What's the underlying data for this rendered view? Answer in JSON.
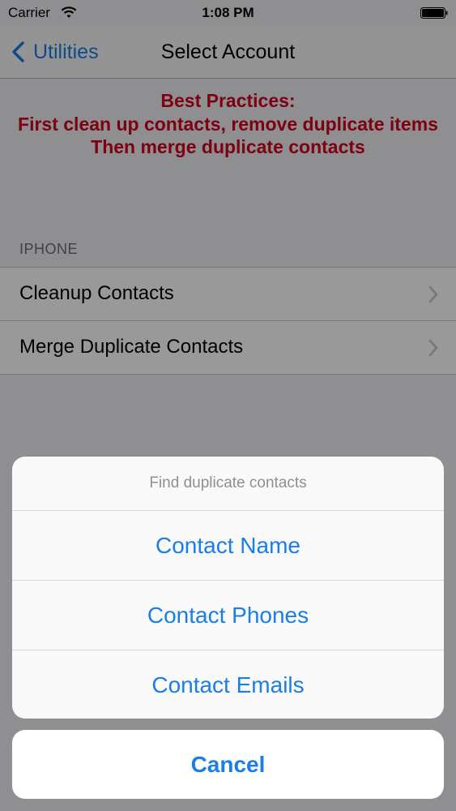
{
  "status_bar": {
    "carrier": "Carrier",
    "time": "1:08 PM",
    "wifi_icon": "wifi-icon",
    "battery_icon": "battery-icon"
  },
  "nav": {
    "back_label": "Utilities",
    "title": "Select Account"
  },
  "notice": {
    "line1": "Best Practices:",
    "line2": "First clean up contacts, remove duplicate items",
    "line3": "Then merge duplicate contacts",
    "color": "#d0021b"
  },
  "section": {
    "header": "IPHONE",
    "items": [
      {
        "label": "Cleanup Contacts"
      },
      {
        "label": "Merge Duplicate Contacts"
      }
    ]
  },
  "action_sheet": {
    "title": "Find duplicate contacts",
    "options": [
      {
        "label": "Contact Name"
      },
      {
        "label": "Contact Phones"
      },
      {
        "label": "Contact Emails"
      }
    ],
    "cancel_label": "Cancel"
  },
  "colors": {
    "accent": "#1a7ee6",
    "background": "#efeff4"
  }
}
